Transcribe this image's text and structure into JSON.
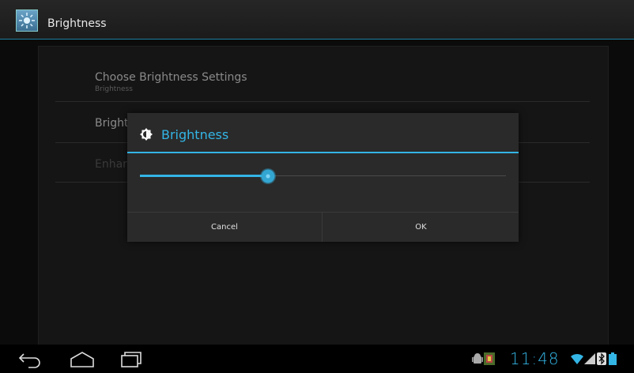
{
  "action_bar": {
    "title": "Brightness"
  },
  "preferences": [
    {
      "title": "Choose Brightness Settings",
      "summary": "Brightness"
    },
    {
      "title": "Brightness"
    },
    {
      "title": "Enhanced"
    }
  ],
  "dialog": {
    "title": "Brightness",
    "slider_level_percent": 35,
    "cancel_label": "Cancel",
    "ok_label": "OK"
  },
  "status_bar": {
    "time": "11:48",
    "icons": [
      "android-debug-icon",
      "app-notification-icon",
      "wifi-icon",
      "signal-icon",
      "bluetooth-icon",
      "battery-icon"
    ]
  },
  "navigation": [
    "back-icon",
    "home-icon",
    "recents-icon"
  ],
  "colors": {
    "accent": "#33b5e5",
    "dialog_bg": "#2a2a2a",
    "background": "#000000"
  }
}
